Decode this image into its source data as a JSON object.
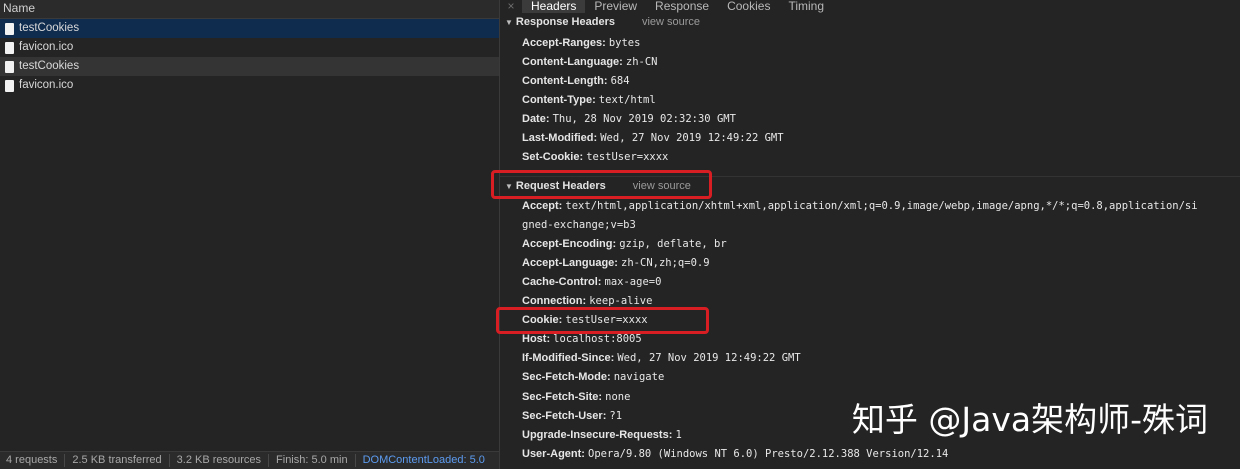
{
  "request_list": {
    "column_header": "Name",
    "items": [
      {
        "name": "testCookies",
        "state": "selected"
      },
      {
        "name": "favicon.ico",
        "state": ""
      },
      {
        "name": "testCookies",
        "state": "hover"
      },
      {
        "name": "favicon.ico",
        "state": ""
      }
    ]
  },
  "status_bar": {
    "requests": "4 requests",
    "transferred": "2.5 KB transferred",
    "resources": "3.2 KB resources",
    "finish": "Finish: 5.0 min",
    "dom_loaded": "DOMContentLoaded: 5.0"
  },
  "tabs": {
    "close": "×",
    "items": [
      "Headers",
      "Preview",
      "Response",
      "Cookies",
      "Timing"
    ],
    "active": "Headers"
  },
  "response_headers": {
    "title": "Response Headers",
    "view_source": "view source",
    "rows": [
      {
        "k": "Accept-Ranges:",
        "v": "bytes"
      },
      {
        "k": "Content-Language:",
        "v": "zh-CN"
      },
      {
        "k": "Content-Length:",
        "v": "684"
      },
      {
        "k": "Content-Type:",
        "v": "text/html"
      },
      {
        "k": "Date:",
        "v": "Thu, 28 Nov 2019 02:32:30 GMT"
      },
      {
        "k": "Last-Modified:",
        "v": "Wed, 27 Nov 2019 12:49:22 GMT"
      },
      {
        "k": "Set-Cookie:",
        "v": "testUser=xxxx"
      }
    ]
  },
  "request_headers": {
    "title": "Request Headers",
    "view_source": "view source",
    "rows": [
      {
        "k": "Accept:",
        "v": "text/html,application/xhtml+xml,application/xml;q=0.9,image/webp,image/apng,*/*;q=0.8,application/si"
      },
      {
        "k": "",
        "v": "gned-exchange;v=b3"
      },
      {
        "k": "Accept-Encoding:",
        "v": "gzip, deflate, br"
      },
      {
        "k": "Accept-Language:",
        "v": "zh-CN,zh;q=0.9"
      },
      {
        "k": "Cache-Control:",
        "v": "max-age=0"
      },
      {
        "k": "Connection:",
        "v": "keep-alive"
      },
      {
        "k": "Cookie:",
        "v": "testUser=xxxx"
      },
      {
        "k": "Host:",
        "v": "localhost:8005"
      },
      {
        "k": "If-Modified-Since:",
        "v": "Wed, 27 Nov 2019 12:49:22 GMT"
      },
      {
        "k": "Sec-Fetch-Mode:",
        "v": "navigate"
      },
      {
        "k": "Sec-Fetch-Site:",
        "v": "none"
      },
      {
        "k": "Sec-Fetch-User:",
        "v": "?1"
      },
      {
        "k": "Upgrade-Insecure-Requests:",
        "v": "1"
      },
      {
        "k": "User-Agent:",
        "v": "Opera/9.80 (Windows NT 6.0) Presto/2.12.388 Version/12.14"
      }
    ]
  },
  "watermark": "知乎 @Java架构师-殊词",
  "colors": {
    "highlight_box": "#d81e23",
    "selected_row": "#0f2c4f",
    "dom_loaded_text": "#5c9bf0"
  }
}
